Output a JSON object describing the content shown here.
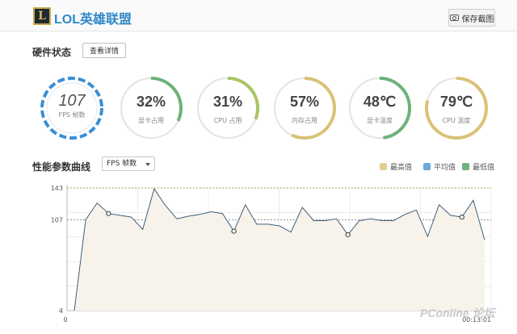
{
  "header": {
    "logo_letter": "L",
    "title": "LOL英雄联盟",
    "save_label": "保存截图"
  },
  "hardware": {
    "title": "硬件状态",
    "detail_label": "查看详情",
    "gauges": [
      {
        "value": "107",
        "label": "FPS 帧数",
        "percent": 100,
        "color": "#3a8fd4"
      },
      {
        "value": "32%",
        "label": "显卡占用",
        "percent": 32,
        "color": "#6cb27a"
      },
      {
        "value": "31%",
        "label": "CPU 占用",
        "percent": 31,
        "color": "#a9c464"
      },
      {
        "value": "57%",
        "label": "内存占用",
        "percent": 57,
        "color": "#d9c277"
      },
      {
        "value": "48℃",
        "label": "显卡温度",
        "percent": 48,
        "color": "#6cb27a"
      },
      {
        "value": "79℃",
        "label": "CPU 温度",
        "percent": 79,
        "color": "#d9c277"
      }
    ]
  },
  "performance": {
    "title": "性能参数曲线",
    "select_value": "FPS 帧数",
    "legend": [
      {
        "label": "最高值",
        "color": "#e1cf91"
      },
      {
        "label": "平均值",
        "color": "#6aa8d8"
      },
      {
        "label": "最低值",
        "color": "#6fb27f"
      }
    ]
  },
  "chart_data": {
    "type": "area",
    "y_ticks": [
      "143",
      "107",
      "4"
    ],
    "ylim": [
      4,
      143
    ],
    "x_tick_labels": [
      "0",
      "00:13:01"
    ],
    "reference_lines": {
      "max": 143,
      "avg": 107
    },
    "values": [
      4,
      107,
      126,
      114,
      112,
      110,
      96,
      142,
      123,
      108,
      111,
      113,
      116,
      114,
      94,
      124,
      102,
      102,
      100,
      93,
      121,
      106,
      106,
      108,
      90,
      106,
      108,
      106,
      106,
      113,
      118,
      88,
      124,
      112,
      110,
      129,
      84
    ],
    "markers": [
      3,
      14,
      24,
      34
    ]
  },
  "watermark": "PConline 论坛"
}
